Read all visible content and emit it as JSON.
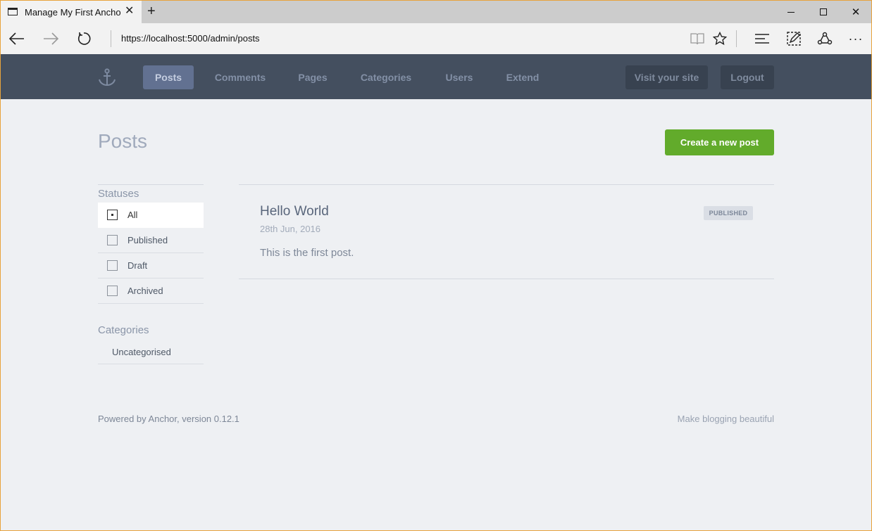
{
  "browser": {
    "tab_title": "Manage My First Ancho",
    "tab_close_glyph": "✕",
    "new_tab_glyph": "+",
    "url": "https://localhost:5000/admin/posts",
    "window_controls": {
      "minimize": "minimize",
      "maximize": "maximize",
      "close": "✕"
    },
    "icons": {
      "back": "arrow-left-icon",
      "forward": "arrow-right-icon",
      "refresh": "refresh-icon",
      "reading_view": "book-icon",
      "favorite": "star-icon",
      "hub": "hub-icon",
      "web_note": "pen-icon",
      "share": "share-icon",
      "more": "more-icon"
    }
  },
  "header": {
    "logo": "anchor-icon",
    "nav": [
      {
        "label": "Posts",
        "active": true
      },
      {
        "label": "Comments",
        "active": false
      },
      {
        "label": "Pages",
        "active": false
      },
      {
        "label": "Categories",
        "active": false
      },
      {
        "label": "Users",
        "active": false
      },
      {
        "label": "Extend",
        "active": false
      }
    ],
    "visit_site_label": "Visit your site",
    "logout_label": "Logout"
  },
  "main": {
    "title": "Posts",
    "create_button_label": "Create a new post",
    "statuses_heading": "Statuses",
    "statuses": [
      {
        "label": "All",
        "selected": true
      },
      {
        "label": "Published",
        "selected": false
      },
      {
        "label": "Draft",
        "selected": false
      },
      {
        "label": "Archived",
        "selected": false
      }
    ],
    "categories_heading": "Categories",
    "categories": [
      {
        "label": "Uncategorised"
      }
    ],
    "posts": [
      {
        "title": "Hello World",
        "date": "28th Jun, 2016",
        "excerpt": "This is the first post.",
        "status_badge": "PUBLISHED"
      }
    ]
  },
  "footer": {
    "powered_by": "Powered by Anchor, version 0.12.1",
    "tagline": "Make blogging beautiful"
  },
  "colors": {
    "header_bg": "#444f5f",
    "nav_active_bg": "#627191",
    "create_button_bg": "#62ab2b",
    "page_bg": "#eef0f3",
    "window_border": "#e8a33c"
  }
}
